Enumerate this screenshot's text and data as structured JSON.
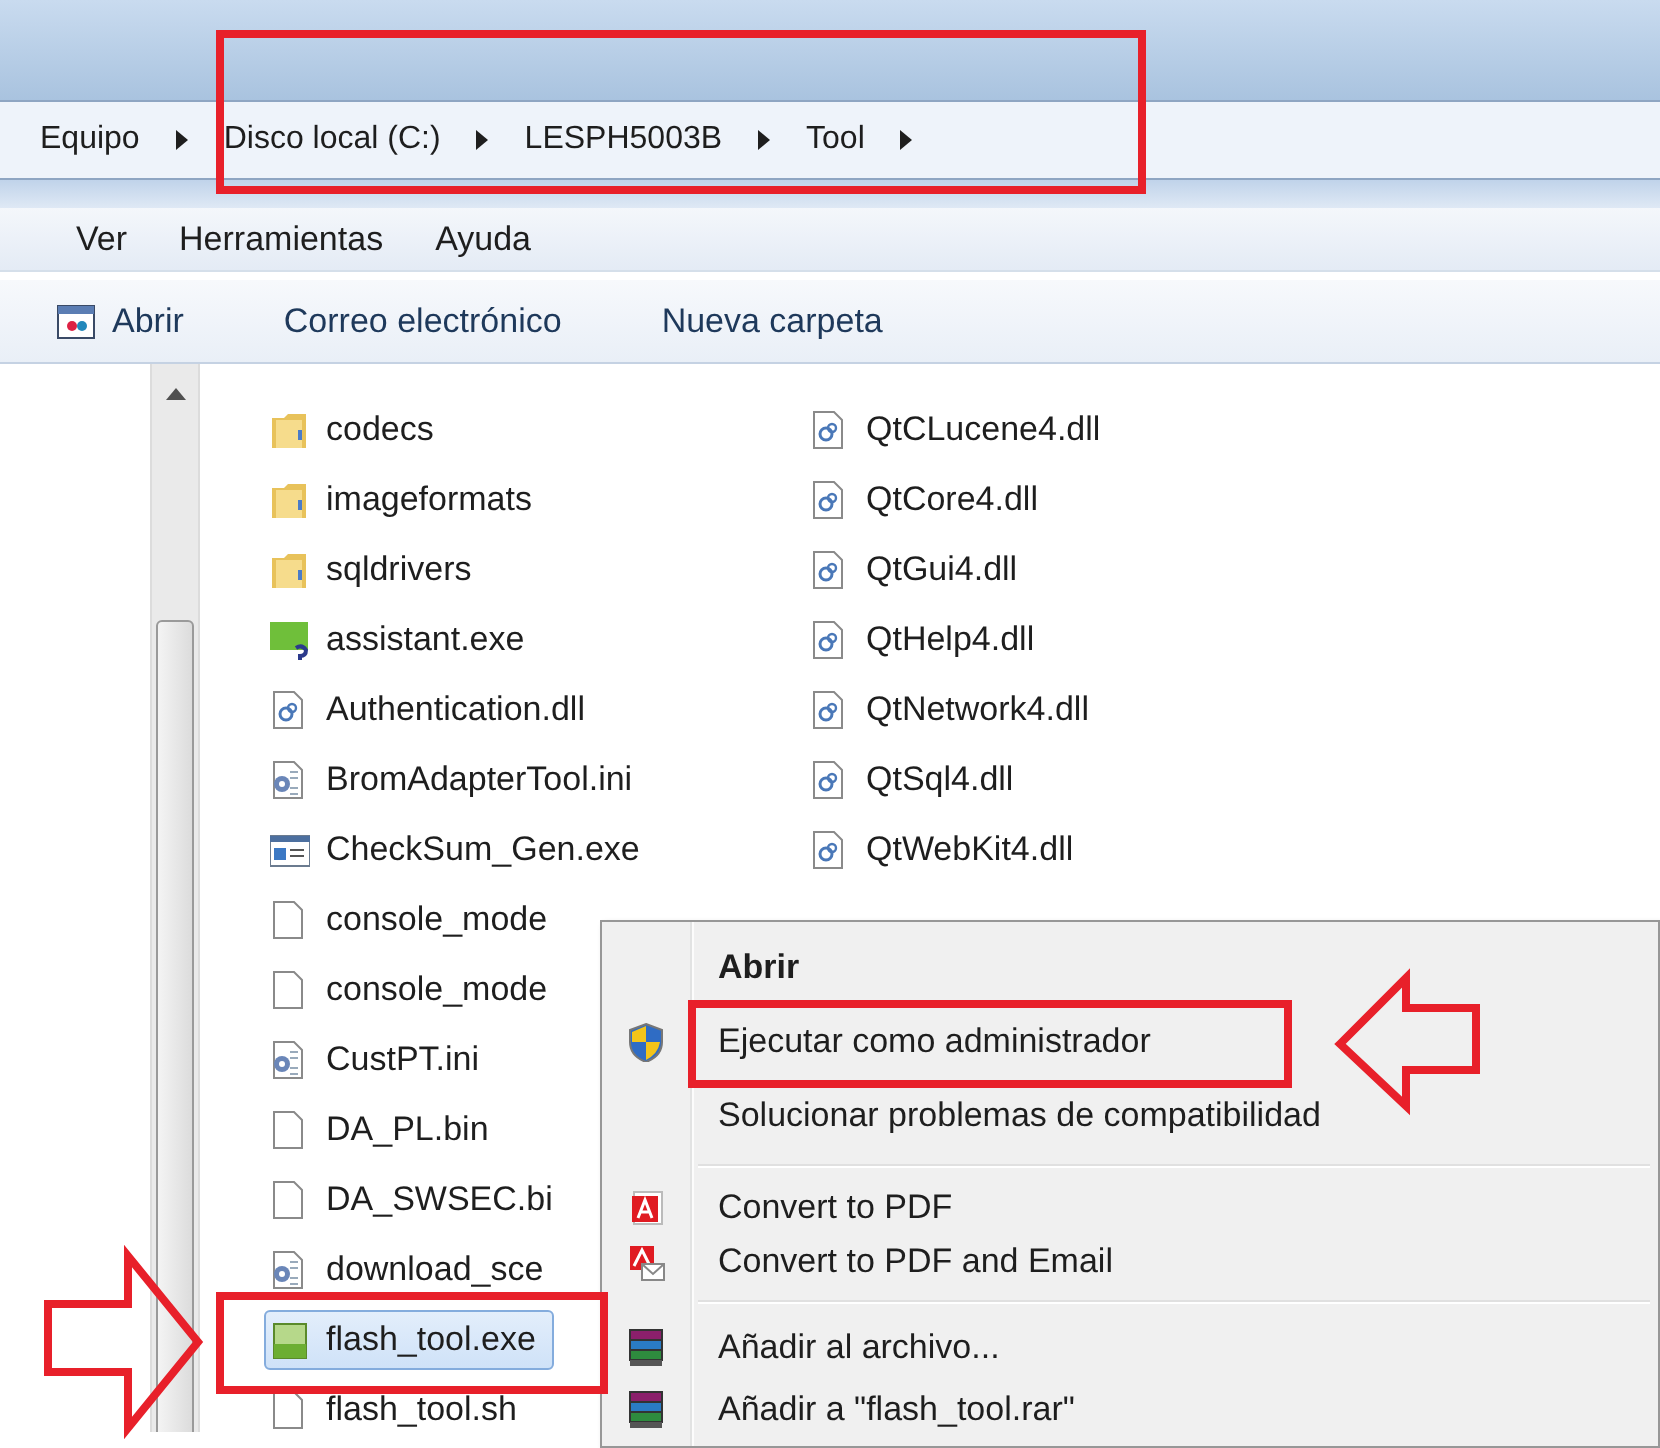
{
  "breadcrumb": [
    {
      "label": "Equipo"
    },
    {
      "label": "Disco local (C:)"
    },
    {
      "label": "LESPH5003B"
    },
    {
      "label": "Tool"
    }
  ],
  "menu_bar": [
    "Ver",
    "Herramientas",
    "Ayuda"
  ],
  "toolbar": [
    {
      "label": "Abrir",
      "kind": "open"
    },
    {
      "label": "Correo electrónico",
      "kind": "text"
    },
    {
      "label": "Nueva carpeta",
      "kind": "text"
    }
  ],
  "files_column_1": [
    {
      "name": "codecs",
      "kind": "folder",
      "selected": false
    },
    {
      "name": "imageformats",
      "kind": "folder",
      "selected": false
    },
    {
      "name": "sqldrivers",
      "kind": "folder",
      "selected": false
    },
    {
      "name": "assistant.exe",
      "kind": "qt",
      "selected": false
    },
    {
      "name": "Authentication.dll",
      "kind": "dll",
      "selected": false
    },
    {
      "name": "BromAdapterTool.ini",
      "kind": "ini",
      "selected": false
    },
    {
      "name": "CheckSum_Gen.exe",
      "kind": "exe",
      "selected": false
    },
    {
      "name": "console_mode",
      "kind": "blank",
      "selected": false
    },
    {
      "name": "console_mode",
      "kind": "blank",
      "selected": false
    },
    {
      "name": "CustPT.ini",
      "kind": "ini",
      "selected": false
    },
    {
      "name": "DA_PL.bin",
      "kind": "blank",
      "selected": false
    },
    {
      "name": "DA_SWSEC.bi",
      "kind": "blank",
      "selected": false
    },
    {
      "name": "download_sce",
      "kind": "ini",
      "selected": false
    },
    {
      "name": "flash_tool.exe",
      "kind": "app",
      "selected": true
    },
    {
      "name": "flash_tool.sh",
      "kind": "blank",
      "selected": false
    }
  ],
  "files_column_2": [
    {
      "name": "QtCLucene4.dll",
      "kind": "dll",
      "selected": false
    },
    {
      "name": "QtCore4.dll",
      "kind": "dll",
      "selected": false
    },
    {
      "name": "QtGui4.dll",
      "kind": "dll",
      "selected": false
    },
    {
      "name": "QtHelp4.dll",
      "kind": "dll",
      "selected": false
    },
    {
      "name": "QtNetwork4.dll",
      "kind": "dll",
      "selected": false
    },
    {
      "name": "QtSql4.dll",
      "kind": "dll",
      "selected": false
    },
    {
      "name": "QtWebKit4.dll",
      "kind": "dll",
      "selected": false
    }
  ],
  "context_menu": [
    {
      "label": "Abrir",
      "kind": "default",
      "separator_before": false
    },
    {
      "label": "Ejecutar como administrador",
      "kind": "shield",
      "separator_before": false
    },
    {
      "label": "Solucionar problemas de compatibilidad",
      "kind": "plain",
      "separator_before": false
    },
    {
      "label": "Convert to PDF",
      "kind": "pdf",
      "separator_before": true
    },
    {
      "label": "Convert to PDF and Email",
      "kind": "pdf-mail",
      "separator_before": false
    },
    {
      "label": "Añadir al archivo...",
      "kind": "archive",
      "separator_before": true
    },
    {
      "label": "Añadir a \"flash_tool.rar\"",
      "kind": "archive",
      "separator_before": false
    }
  ]
}
